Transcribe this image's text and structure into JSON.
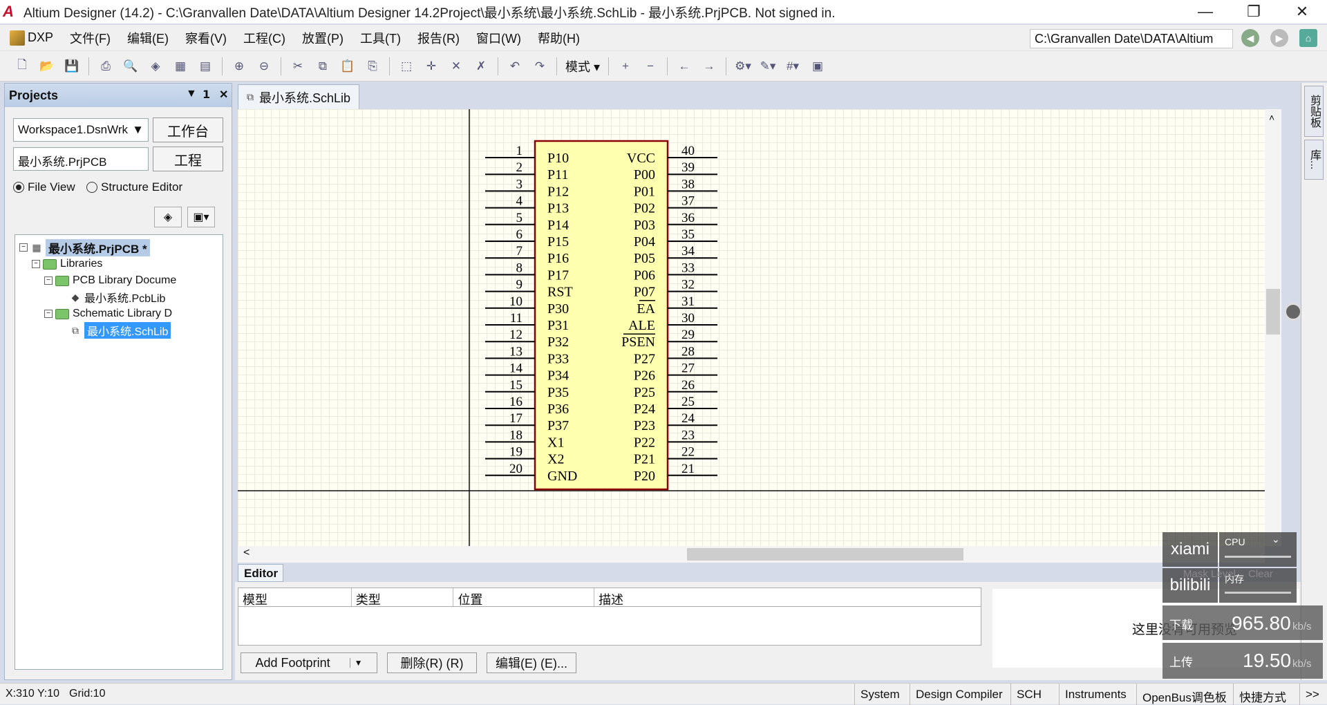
{
  "window": {
    "title": "Altium Designer (14.2) - C:\\Granvallen Date\\DATA\\Altium Designer 14.2Project\\最小系统\\最小系统.SchLib - 最小系统.PrjPCB. Not signed in."
  },
  "menu": {
    "items": [
      "DXP",
      "文件(F)",
      "编辑(E)",
      "察看(V)",
      "工程(C)",
      "放置(P)",
      "工具(T)",
      "报告(R)",
      "窗口(W)",
      "帮助(H)"
    ],
    "path": "C:\\Granvallen Date\\DATA\\Altium"
  },
  "toolbar": {
    "mode_label": "模式"
  },
  "projects": {
    "title": "Projects",
    "workspace_combo": "Workspace1.DsnWrk",
    "workspace_button": "工作台",
    "project_combo": "最小系统.PrjPCB",
    "project_button": "工程",
    "file_view": "File View",
    "structure_editor": "Structure Editor",
    "tree": {
      "project": "最小系统.PrjPCB *",
      "libraries": "Libraries",
      "pcb_folder": "PCB Library Docume",
      "pcb_file": "最小系统.PcbLib",
      "sch_folder": "Schematic Library D",
      "sch_file": "最小系统.SchLib"
    }
  },
  "document_tab": "最小系统.SchLib",
  "component": {
    "left_pins": [
      {
        "num": "1",
        "name": "P10"
      },
      {
        "num": "2",
        "name": "P11"
      },
      {
        "num": "3",
        "name": "P12"
      },
      {
        "num": "4",
        "name": "P13"
      },
      {
        "num": "5",
        "name": "P14"
      },
      {
        "num": "6",
        "name": "P15"
      },
      {
        "num": "7",
        "name": "P16"
      },
      {
        "num": "8",
        "name": "P17"
      },
      {
        "num": "9",
        "name": "RST"
      },
      {
        "num": "10",
        "name": "P30"
      },
      {
        "num": "11",
        "name": "P31"
      },
      {
        "num": "12",
        "name": "P32"
      },
      {
        "num": "13",
        "name": "P33"
      },
      {
        "num": "14",
        "name": "P34"
      },
      {
        "num": "15",
        "name": "P35"
      },
      {
        "num": "16",
        "name": "P36"
      },
      {
        "num": "17",
        "name": "P37"
      },
      {
        "num": "18",
        "name": "X1"
      },
      {
        "num": "19",
        "name": "X2"
      },
      {
        "num": "20",
        "name": "GND"
      }
    ],
    "right_pins": [
      {
        "num": "40",
        "name": "VCC"
      },
      {
        "num": "39",
        "name": "P00"
      },
      {
        "num": "38",
        "name": "P01"
      },
      {
        "num": "37",
        "name": "P02"
      },
      {
        "num": "36",
        "name": "P03"
      },
      {
        "num": "35",
        "name": "P04"
      },
      {
        "num": "34",
        "name": "P05"
      },
      {
        "num": "33",
        "name": "P06"
      },
      {
        "num": "32",
        "name": "P07"
      },
      {
        "num": "31",
        "name": "EA",
        "overline": true
      },
      {
        "num": "30",
        "name": "ALE"
      },
      {
        "num": "29",
        "name": "PSEN",
        "overline": true
      },
      {
        "num": "28",
        "name": "P27"
      },
      {
        "num": "27",
        "name": "P26"
      },
      {
        "num": "26",
        "name": "P25"
      },
      {
        "num": "25",
        "name": "P24"
      },
      {
        "num": "24",
        "name": "P23"
      },
      {
        "num": "23",
        "name": "P22"
      },
      {
        "num": "22",
        "name": "P21"
      },
      {
        "num": "21",
        "name": "P20"
      }
    ]
  },
  "editor": {
    "label": "Editor",
    "columns": [
      "模型",
      "类型",
      "位置",
      "描述"
    ],
    "preview_text": "这里没有可用预览",
    "add_footprint": "Add Footprint",
    "delete_button": "删除(R) (R)",
    "edit_button": "编辑(E) (E)..."
  },
  "right_tabs": [
    "剪贴板",
    "库..."
  ],
  "overlay": {
    "xiami": "xiami",
    "bilibili": "bilibili",
    "cpu": "CPU",
    "mem": "内存",
    "mask_level": "Mask Level",
    "clear": "Clear",
    "download_label": "下载",
    "download_value": "965.80",
    "upload_label": "上传",
    "upload_value": "19.50",
    "unit": "kb/s"
  },
  "status": {
    "coords": "X:310 Y:10",
    "grid": "Grid:10",
    "tabs": [
      "System",
      "Design Compiler",
      "SCH",
      "Instruments",
      "OpenBus调色板",
      "快捷方式",
      ">>"
    ]
  },
  "colors": {
    "component_fill": "#ffffb0",
    "component_border": "#8b0000",
    "selection": "#3399ff"
  }
}
